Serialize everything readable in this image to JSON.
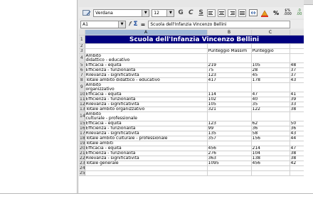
{
  "toolbar": {
    "style_icon": "styles-icon",
    "font_name": "Verdana",
    "font_size": "12",
    "bold_label": "G",
    "italic_label": "C",
    "underline_label": "S"
  },
  "formula_bar": {
    "cell_ref": "A1",
    "content": "Scuola dell'Infanzia Vincenzo Bellini"
  },
  "columns": [
    "A",
    "B",
    "C"
  ],
  "rows": [
    {
      "n": "1",
      "a": "Scuola dell'Infanzia Vincenzo Bellini",
      "b": "",
      "c": "",
      "d": "",
      "type": "title"
    },
    {
      "n": "2",
      "a": "",
      "b": "",
      "c": "",
      "d": ""
    },
    {
      "n": "3",
      "a": "",
      "b": "Punteggio Massim",
      "c": "Punteggio",
      "d": ""
    },
    {
      "n": "4",
      "a": "Ambito\ndidattico - educativo",
      "b": "",
      "c": "",
      "d": "",
      "type": "tall"
    },
    {
      "n": "5",
      "a": "Efficacia - equità",
      "b": "219",
      "c": "105",
      "d": "48"
    },
    {
      "n": "6",
      "a": "Efficienza - funzionalità",
      "b": "75",
      "c": "28",
      "d": "37"
    },
    {
      "n": "7",
      "a": "Rilevanza - significatività",
      "b": "123",
      "c": "45",
      "d": "37"
    },
    {
      "n": "8",
      "a": "Totale ambito didattico - educativo",
      "b": "417",
      "c": "178",
      "d": "43"
    },
    {
      "n": "9",
      "a": "Ambito\norganizzativo",
      "b": "",
      "c": "",
      "d": "",
      "type": "tall"
    },
    {
      "n": "10",
      "a": "Efficacia - equità",
      "b": "114",
      "c": "47",
      "d": "41"
    },
    {
      "n": "11",
      "a": "Efficienza - funzionalità",
      "b": "102",
      "c": "40",
      "d": "39"
    },
    {
      "n": "12",
      "a": "Rilevanza - significatività",
      "b": "105",
      "c": "35",
      "d": "33"
    },
    {
      "n": "13",
      "a": "Totale ambito organizzativo",
      "b": "321",
      "c": "122",
      "d": "38"
    },
    {
      "n": "14",
      "a": "Ambito\nculturale - professionale",
      "b": "",
      "c": "",
      "d": "",
      "type": "tall"
    },
    {
      "n": "15",
      "a": "Efficacia - equità",
      "b": "123",
      "c": "62",
      "d": "50"
    },
    {
      "n": "16",
      "a": "Efficienza - funzionalità",
      "b": "99",
      "c": "36",
      "d": "36"
    },
    {
      "n": "17",
      "a": "Rilevanza - significatività",
      "b": "135",
      "c": "58",
      "d": "43"
    },
    {
      "n": "18",
      "a": "Totale ambito culturale - professionale",
      "b": "357",
      "c": "156",
      "d": "44"
    },
    {
      "n": "19",
      "a": "Totale ambiti",
      "b": "",
      "c": "",
      "d": ""
    },
    {
      "n": "20",
      "a": "Efficacia - equità",
      "b": "456",
      "c": "214",
      "d": "47"
    },
    {
      "n": "21",
      "a": "Efficienza - funzionalità",
      "b": "276",
      "c": "104",
      "d": "38"
    },
    {
      "n": "22",
      "a": "Rilevanza - significatività",
      "b": "363",
      "c": "138",
      "d": "38"
    },
    {
      "n": "23",
      "a": "Totale generale",
      "b": "1095",
      "c": "456",
      "d": "42"
    },
    {
      "n": "24",
      "a": "",
      "b": "",
      "c": "",
      "d": ""
    },
    {
      "n": "25",
      "a": "",
      "b": "",
      "c": "",
      "d": ""
    }
  ],
  "colors": {
    "title_bg": "#00007f",
    "title_fg": "#ffffff",
    "active_col": "#9fb8d6"
  }
}
